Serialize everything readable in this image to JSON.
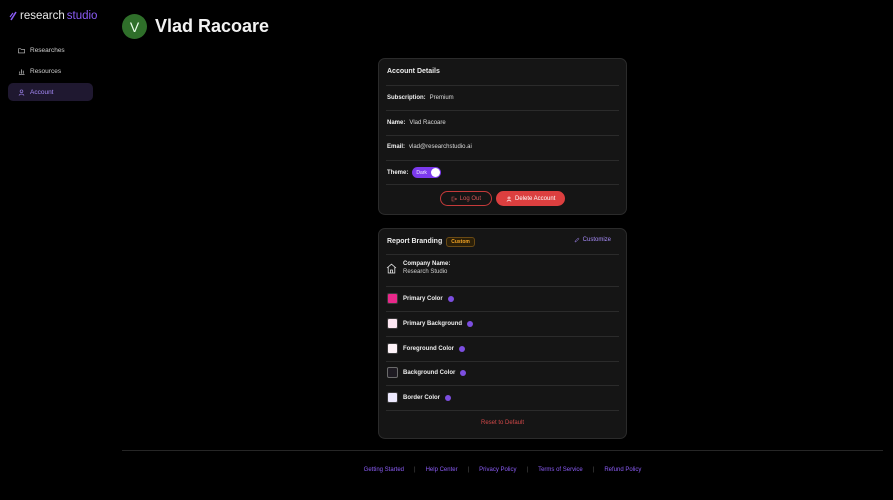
{
  "logo": {
    "word1": "research",
    "word2": "studio"
  },
  "sidebar": {
    "items": [
      {
        "label": "Researches",
        "icon": "folder-icon"
      },
      {
        "label": "Resources",
        "icon": "bar-chart-icon"
      },
      {
        "label": "Account",
        "icon": "user-icon",
        "active": true
      }
    ]
  },
  "header": {
    "avatar_initial": "V",
    "title": "Vlad Racoare"
  },
  "account": {
    "title": "Account Details",
    "subscription_label": "Subscription:",
    "subscription_value": "Premium",
    "name_label": "Name:",
    "name_value": "Vlad Racoare",
    "email_label": "Email:",
    "email_value": "vlad@researchstudio.ai",
    "theme_label": "Theme:",
    "theme_value": "Dark",
    "logout_label": "Log Out",
    "delete_label": "Delete Account"
  },
  "branding": {
    "title": "Report Branding",
    "badge": "Custom",
    "customize_label": "Customize",
    "company_label": "Company Name:",
    "company_value": "Research Studio",
    "colors": [
      {
        "label": "Primary Color",
        "color": "#e8288a"
      },
      {
        "label": "Primary Background",
        "color": "#fce7f3"
      },
      {
        "label": "Foreground Color",
        "color": "#fdf2f8"
      },
      {
        "label": "Background Color",
        "color": "#1e1b22"
      },
      {
        "label": "Border Color",
        "color": "#ede9fe"
      }
    ],
    "reset_label": "Reset to Default"
  },
  "footer": {
    "links": [
      "Getting Started",
      "Help Center",
      "Privacy Policy",
      "Terms of Service",
      "Refund Policy"
    ]
  },
  "colors": {
    "accent": "#8b5cf6",
    "danger": "#dc3f3f",
    "avatar": "#2f6f2a"
  }
}
